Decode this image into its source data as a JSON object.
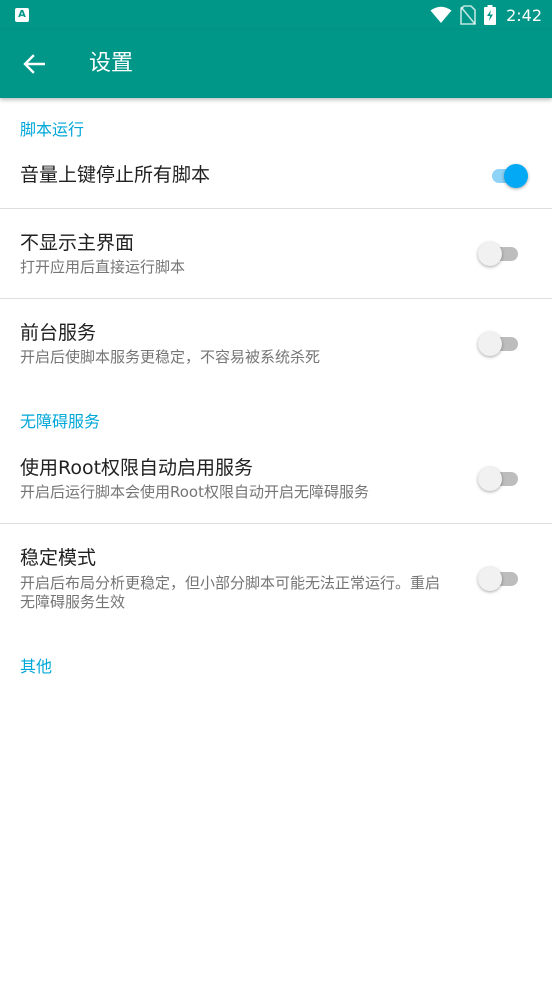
{
  "status_bar": {
    "app_badge": "A",
    "time": "2:42",
    "icons": [
      "wifi-icon",
      "no-sim-icon",
      "battery-charging-icon"
    ]
  },
  "app_bar": {
    "title": "设置",
    "back_icon": "arrow-back-icon"
  },
  "categories": {
    "script_run": "脚本运行",
    "accessibility": "无障碍服务",
    "other": "其他"
  },
  "preferences": {
    "volume_stop": {
      "title": "音量上键停止所有脚本",
      "enabled": true
    },
    "hide_main": {
      "title": "不显示主界面",
      "summary": "打开应用后直接运行脚本",
      "enabled": false
    },
    "foreground": {
      "title": "前台服务",
      "summary": "开启后使脚本服务更稳定，不容易被系统杀死",
      "enabled": false
    },
    "root_accessibility": {
      "title": "使用Root权限自动启用服务",
      "summary": "开启后运行脚本会使用Root权限自动开启无障碍服务",
      "enabled": false
    },
    "stable_mode": {
      "title": "稳定模式",
      "summary": "开启后布局分析更稳定，但小部分脚本可能无法正常运行。重启无障碍服务生效",
      "enabled": false
    }
  },
  "colors": {
    "primary": "#009688",
    "accent": "#03a9f4",
    "category_text": "#00a7d8"
  }
}
